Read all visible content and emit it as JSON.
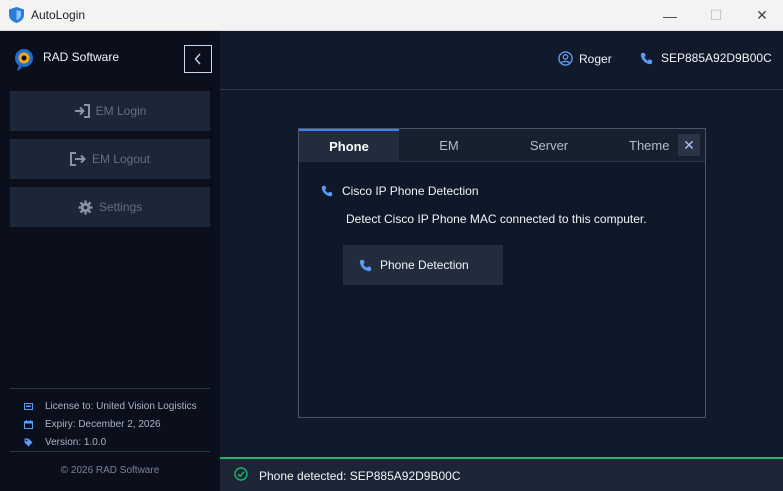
{
  "window": {
    "title": "AutoLogin",
    "minimize_glyph": "—",
    "maximize_glyph": "☐",
    "close_glyph": "✕"
  },
  "sidebar": {
    "brand": "RAD Software",
    "collapse_icon": "chevron-left-icon",
    "nav": [
      {
        "label": "EM Login",
        "icon": "sign-in-icon"
      },
      {
        "label": "EM Logout",
        "icon": "sign-out-icon"
      },
      {
        "label": "Settings",
        "icon": "gear-icon"
      }
    ],
    "license": "License to: United Vision Logistics",
    "expiry": "Expiry: December 2, 2026",
    "version": "Version: 1.0.0",
    "copyright": "© 2026 RAD Software"
  },
  "header": {
    "user": "Roger",
    "device": "SEP885A92D9B00C"
  },
  "dialog": {
    "tabs": [
      "Phone",
      "EM",
      "Server",
      "Theme"
    ],
    "active_tab": "Phone",
    "close_glyph": "✕",
    "section_title": "Cisco IP Phone Detection",
    "description": "Detect Cisco IP Phone MAC connected to this computer.",
    "button_label": "Phone Detection"
  },
  "status": {
    "text": "Phone detected: SEP885A92D9B00C",
    "color": "#22b36a"
  },
  "colors": {
    "accent": "#3b82f6",
    "success": "#22b36a",
    "sidebar_bg": "#0a0f1b",
    "main_bg": "#111a2a"
  }
}
